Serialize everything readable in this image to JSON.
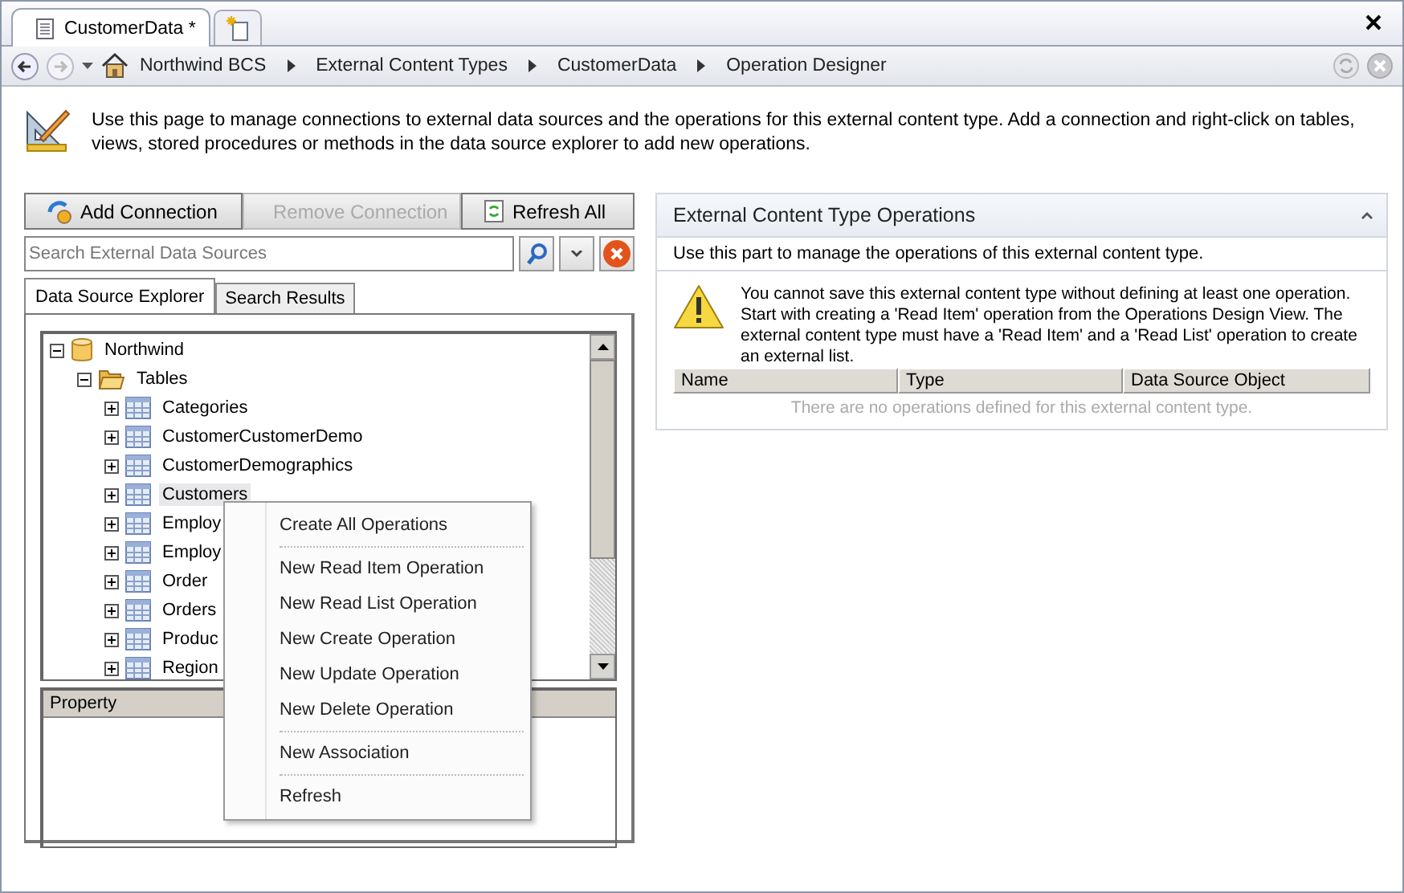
{
  "document_tabs": [
    {
      "label": "CustomerData *",
      "selected": true
    }
  ],
  "breadcrumb": [
    "Northwind BCS",
    "External Content Types",
    "CustomerData",
    "Operation Designer"
  ],
  "description": "Use this page to manage connections to external data sources and the operations for this external content type. Add a connection and right-click on tables, views, stored procedures or methods in the data source explorer to add new operations.",
  "toolbar": [
    {
      "label": "Add Connection",
      "kind": "add",
      "disabled": false
    },
    {
      "label": "Remove Connection",
      "kind": "remove",
      "disabled": true
    },
    {
      "label": "Refresh All",
      "kind": "refresh",
      "disabled": false
    }
  ],
  "search": {
    "placeholder": "Search External Data Sources"
  },
  "explorer_tabs": [
    {
      "label": "Data Source Explorer",
      "selected": true
    },
    {
      "label": "Search Results",
      "selected": false
    }
  ],
  "tree": [
    {
      "label": "Northwind",
      "kind": "database",
      "expanded": true,
      "selected": false,
      "children": [
        {
          "label": "Tables",
          "kind": "folder",
          "expanded": true,
          "selected": false,
          "children": [
            {
              "label": "Categories",
              "kind": "table",
              "expanded": false,
              "selected": false
            },
            {
              "label": "CustomerCustomerDemo",
              "kind": "table",
              "expanded": false,
              "selected": false
            },
            {
              "label": "CustomerDemographics",
              "kind": "table",
              "expanded": false,
              "selected": false
            },
            {
              "label": "Customers",
              "kind": "table",
              "expanded": false,
              "selected": true
            },
            {
              "label": "Employ",
              "kind": "table",
              "expanded": false,
              "selected": false
            },
            {
              "label": "Employ",
              "kind": "table",
              "expanded": false,
              "selected": false
            },
            {
              "label": "Order",
              "kind": "table",
              "expanded": false,
              "selected": false
            },
            {
              "label": "Orders",
              "kind": "table",
              "expanded": false,
              "selected": false
            },
            {
              "label": "Produc",
              "kind": "table",
              "expanded": false,
              "selected": false
            },
            {
              "label": "Region",
              "kind": "table",
              "expanded": false,
              "selected": false
            }
          ]
        }
      ]
    }
  ],
  "property_grid": {
    "columns": [
      "Property"
    ]
  },
  "context_menu": [
    {
      "kind": "item",
      "label": "Create All Operations"
    },
    {
      "kind": "separator"
    },
    {
      "kind": "item",
      "label": "New Read Item Operation"
    },
    {
      "kind": "item",
      "label": "New Read List Operation"
    },
    {
      "kind": "item",
      "label": "New Create Operation"
    },
    {
      "kind": "item",
      "label": "New Update Operation"
    },
    {
      "kind": "item",
      "label": "New Delete Operation"
    },
    {
      "kind": "separator"
    },
    {
      "kind": "item",
      "label": "New Association"
    },
    {
      "kind": "separator"
    },
    {
      "kind": "item",
      "label": "Refresh"
    }
  ],
  "operations_panel": {
    "title": "External Content Type Operations",
    "subtitle": "Use this part to manage the operations of this external content type.",
    "warning": "You cannot save this external content type without defining at least one operation. Start with creating a 'Read Item' operation from the Operations Design View. The external content type must have a 'Read Item' and a 'Read List' operation to create an external list.",
    "columns": [
      "Name",
      "Type",
      "Data Source Object"
    ],
    "empty_text": "There are no operations defined for this external content type."
  }
}
